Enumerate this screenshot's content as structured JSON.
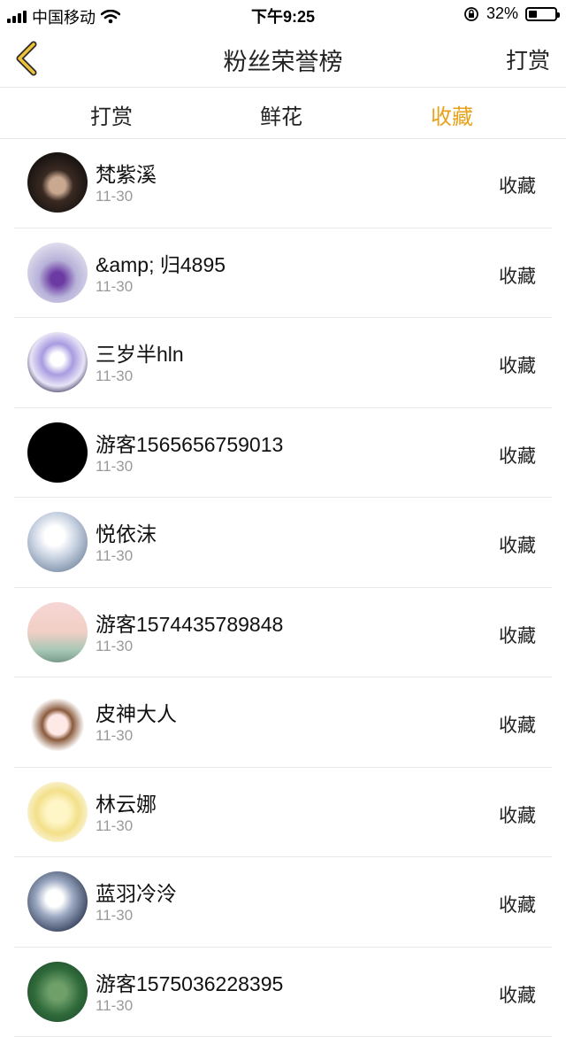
{
  "status_bar": {
    "carrier": "中国移动",
    "time": "下午9:25",
    "battery": "32%",
    "battery_level": 0.32
  },
  "nav": {
    "title": "粉丝荣誉榜",
    "right_label": "打赏",
    "back_icon": "chevron-left-icon"
  },
  "tabs": [
    {
      "label": "打赏",
      "active": false
    },
    {
      "label": "鲜花",
      "active": false
    },
    {
      "label": "收藏",
      "active": true
    }
  ],
  "colors": {
    "accent": "#e6a21a",
    "divider": "#e9e9e9",
    "secondary_text": "#999999"
  },
  "fans": [
    {
      "name": "梵紫溪",
      "date": "11-30",
      "action": "收藏"
    },
    {
      "name": "&amp; 归4895",
      "date": "11-30",
      "action": "收藏"
    },
    {
      "name": "三岁半hln",
      "date": "11-30",
      "action": "收藏"
    },
    {
      "name": "游客1565656759013",
      "date": "11-30",
      "action": "收藏"
    },
    {
      "name": "悦依沫",
      "date": "11-30",
      "action": "收藏"
    },
    {
      "name": "游客1574435789848",
      "date": "11-30",
      "action": "收藏"
    },
    {
      "name": "皮神大人",
      "date": "11-30",
      "action": "收藏"
    },
    {
      "name": "林云娜",
      "date": "11-30",
      "action": "收藏"
    },
    {
      "name": "蓝羽冷泠",
      "date": "11-30",
      "action": "收藏"
    },
    {
      "name": "游客1575036228395",
      "date": "11-30",
      "action": "收藏"
    }
  ]
}
